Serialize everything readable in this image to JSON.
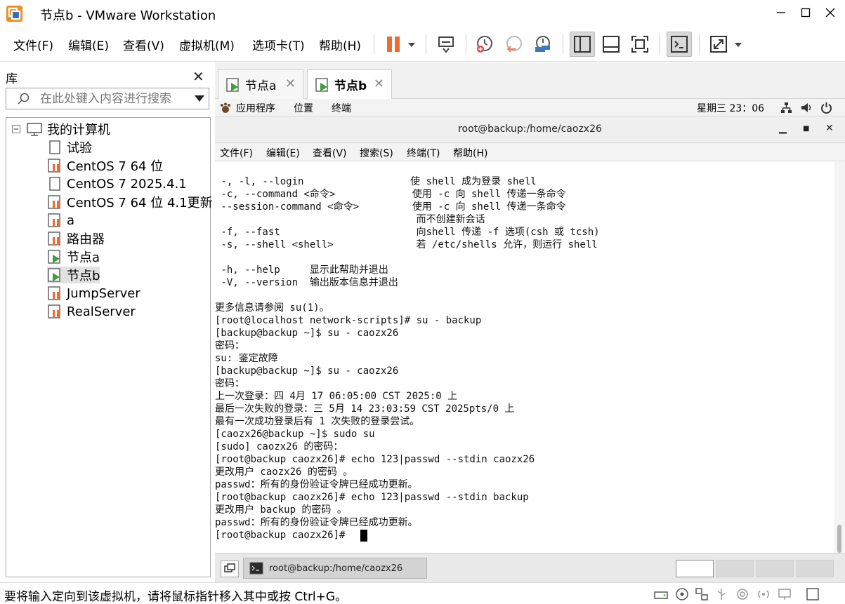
{
  "window": {
    "title": "节点b - VMware Workstation",
    "controls": {
      "minimize": "—",
      "maximize": "☐",
      "close": "✕"
    }
  },
  "menubar": {
    "items": [
      "文件(F)",
      "编辑(E)",
      "查看(V)",
      "虚拟机(M)",
      "选项卡(T)",
      "帮助(H)"
    ]
  },
  "toolbar": {
    "icons": [
      "pause-icon",
      "send-ctrl-alt-del-icon",
      "snapshot-take-icon",
      "snapshot-revert-icon",
      "snapshot-manager-icon",
      "library-view-icon",
      "thumbnail-view-icon",
      "fullscreen-view-icon",
      "console-view-icon",
      "stretch-view-icon"
    ],
    "colors": {
      "pause": "#ef6c2f",
      "snapshot_red": "#e24a3a",
      "snapshot_blue": "#3979c6"
    }
  },
  "library": {
    "title": "库",
    "close": "✕",
    "search_placeholder": "在此处键入内容进行搜索",
    "root": "我的计算机",
    "items": [
      {
        "label": "试验",
        "icon": "vm-off-icon"
      },
      {
        "label": "CentOS 7 64 位",
        "icon": "vm-paused-icon"
      },
      {
        "label": "CentOS 7 2025.4.1",
        "icon": "vm-off-icon"
      },
      {
        "label": "CentOS 7 64 位 4.1更新",
        "icon": "vm-paused-icon"
      },
      {
        "label": "a",
        "icon": "vm-paused-icon"
      },
      {
        "label": "路由器",
        "icon": "vm-paused-icon"
      },
      {
        "label": "节点a",
        "icon": "vm-running-icon"
      },
      {
        "label": "节点b",
        "icon": "vm-running-icon"
      },
      {
        "label": "JumpServer",
        "icon": "vm-paused-icon"
      },
      {
        "label": "RealServer",
        "icon": "vm-paused-icon"
      }
    ]
  },
  "tabs": [
    {
      "label": "节点a",
      "active": false
    },
    {
      "label": "节点b",
      "active": true
    }
  ],
  "guest_topbar": {
    "apps": "应用程序",
    "places": "位置",
    "terminal": "终端",
    "clock": "星期三 23：06"
  },
  "terminal": {
    "title": "root@backup:/home/caozx26",
    "menu": [
      "文件(F)",
      "编辑(E)",
      "查看(V)",
      "搜索(S)",
      "终端(T)",
      "帮助(H)"
    ],
    "lines": [
      " -, -l, --login                  使 shell 成为登录 shell",
      " -c, --command <命令>             使用 -c 向 shell 传递一条命令",
      " --session-command <命令>         使用 -c 向 shell 传递一条命令",
      "                                  而不创建新会话",
      " -f, --fast                       向shell 传递 -f 选项(csh 或 tcsh)",
      " -s, --shell <shell>              若 /etc/shells 允许，则运行 shell",
      "",
      " -h, --help     显示此帮助并退出",
      " -V, --version  输出版本信息并退出",
      "",
      "更多信息请参阅 su(1)。",
      "[root@localhost network-scripts]# su - backup",
      "[backup@backup ~]$ su - caozx26",
      "密码：",
      "su: 鉴定故障",
      "[backup@backup ~]$ su - caozx26",
      "密码：",
      "上一次登录：四 4月 17 06:05:00 CST 2025:0 上",
      "最后一次失败的登录：三 5月 14 23:03:59 CST 2025pts/0 上",
      "最有一次成功登录后有 1 次失败的登录尝试。",
      "[caozx26@backup ~]$ sudo su",
      "[sudo] caozx26 的密码：",
      "[root@backup caozx26]# echo 123|passwd --stdin caozx26",
      "更改用户 caozx26 的密码 。",
      "passwd：所有的身份验证令牌已经成功更新。",
      "[root@backup caozx26]# echo 123|passwd --stdin backup",
      "更改用户 backup 的密码 。",
      "passwd：所有的身份验证令牌已经成功更新。",
      "[root@backup caozx26]# "
    ]
  },
  "taskbar": {
    "task_label": "root@backup:/home/caozx26"
  },
  "statusbar": {
    "message": "要将输入定向到该虚拟机，请将鼠标指针移入其中或按 Ctrl+G。"
  }
}
